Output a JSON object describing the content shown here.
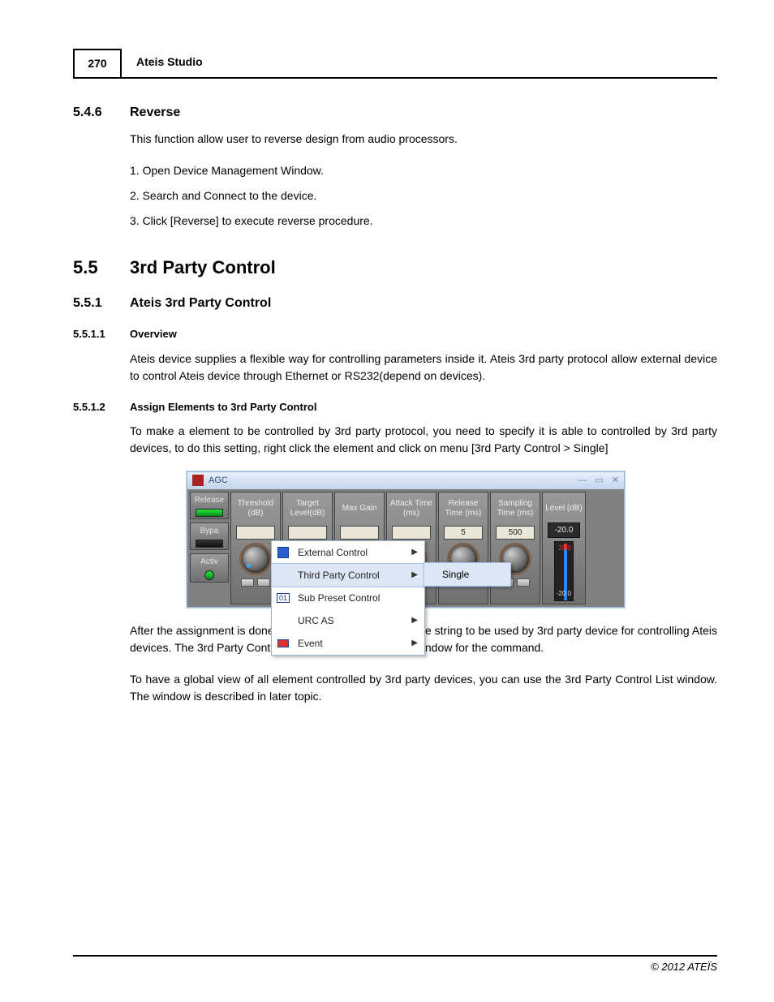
{
  "header": {
    "page_number": "270",
    "title": "Ateis Studio"
  },
  "sections": {
    "s546": {
      "num": "5.4.6",
      "title": "Reverse"
    },
    "s55": {
      "num": "5.5",
      "title": "3rd Party Control"
    },
    "s551": {
      "num": "5.5.1",
      "title": "Ateis 3rd Party Control"
    },
    "s5511": {
      "num": "5.5.1.1",
      "title": "Overview"
    },
    "s5512": {
      "num": "5.5.1.2",
      "title": "Assign Elements to 3rd Party Control"
    }
  },
  "body": {
    "reverse_intro": "This function allow user to reverse design from audio processors.",
    "reverse_steps": [
      "1. Open Device Management Window.",
      "2. Search and Connect to the device.",
      "3. Click [Reverse] to execute reverse procedure."
    ],
    "overview_text": "Ateis device supplies a flexible way for controlling parameters inside it. Ateis 3rd party protocol allow external device to control Ateis device through Ethernet or RS232(depend on devices).",
    "assign_intro": " To make a element to be controlled by 3rd party protocol, you need to specify it is able to controlled by 3rd party devices, to do this setting, right click the element and click on menu [3rd Party Control > Single]",
    "after_assign_1": "After the assignment is done, you can have a preview of the string to be used by 3rd party device for controlling Ateis devices. The 3rd Party Control Command is the preview window for the command.",
    "after_assign_2": "To have a global view of all element controlled by 3rd party devices, you can use the 3rd Party Control List window. The window is described in later topic."
  },
  "agc": {
    "title": "AGC",
    "left_buttons": {
      "release": "Release",
      "bypass": "Bypa",
      "active": "Activ"
    },
    "columns": [
      {
        "label": "Threshold (dB)"
      },
      {
        "label": "Target Level(dB)"
      },
      {
        "label": "Max Gain"
      },
      {
        "label": "Attack Time (ms)"
      },
      {
        "label": "Release Time (ms)",
        "value": "5"
      },
      {
        "label": "Sampling Time (ms)",
        "value": "500"
      }
    ],
    "meter": {
      "label": "Level (dB)",
      "value": "-20.0",
      "scale_top": "20.0",
      "scale_bottom": "-20.0"
    },
    "context_menu": [
      {
        "label": "External Control",
        "arrow": true,
        "icon": "grid-icon"
      },
      {
        "label": "Third Party Control",
        "arrow": true,
        "highlight": true
      },
      {
        "label": "Sub Preset Control",
        "icon": "preset-icon"
      },
      {
        "label": "URC AS",
        "arrow": true
      },
      {
        "label": "Event",
        "arrow": true,
        "icon": "event-icon"
      }
    ],
    "submenu_item": "Single"
  },
  "footer": {
    "copyright": "© 2012 ATEÏS"
  }
}
